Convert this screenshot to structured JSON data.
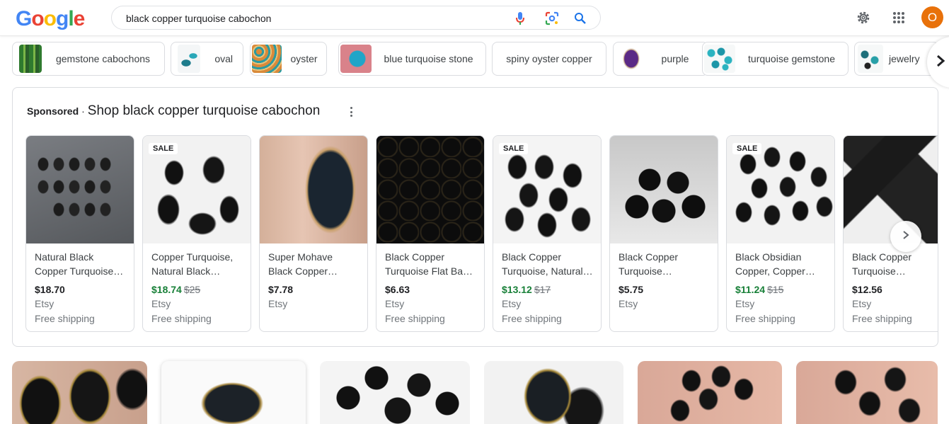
{
  "header": {
    "logo": "Google",
    "search_query": "black copper turquoise cabochon",
    "avatar_initial": "O",
    "icons": [
      "voice-search-icon",
      "lens-icon",
      "search-icon",
      "gear-icon",
      "apps-grid-icon"
    ]
  },
  "chips": [
    {
      "label": "gemstone cabochons"
    },
    {
      "label": "oval"
    },
    {
      "label": "oyster"
    },
    {
      "label": "blue turquoise stone"
    },
    {
      "label": "spiny oyster copper"
    },
    {
      "label": "purple"
    },
    {
      "label": "turquoise gemstone"
    },
    {
      "label": "jewelry"
    }
  ],
  "sponsored": {
    "label": "Sponsored",
    "separator": "·",
    "title": "Shop black copper turquoise cabochon",
    "products": [
      {
        "title1": "Natural Black",
        "title2": "Copper Turquoise…",
        "price": "$18.70",
        "orig": "",
        "store": "Etsy",
        "shipping": "Free shipping",
        "sale": ""
      },
      {
        "title1": "Copper Turquoise,",
        "title2": "Natural Black…",
        "price": "$18.74",
        "orig": "$25",
        "store": "Etsy",
        "shipping": "Free shipping",
        "sale": "SALE"
      },
      {
        "title1": "Super Mohave",
        "title2": "Black Copper…",
        "price": "$7.78",
        "orig": "",
        "store": "Etsy",
        "shipping": "",
        "sale": ""
      },
      {
        "title1": "Black Copper",
        "title2": "Turquoise Flat Ba…",
        "price": "$6.63",
        "orig": "",
        "store": "Etsy",
        "shipping": "Free shipping",
        "sale": ""
      },
      {
        "title1": "Black Copper",
        "title2": "Turquoise, Natural…",
        "price": "$13.12",
        "orig": "$17",
        "store": "Etsy",
        "shipping": "Free shipping",
        "sale": "SALE"
      },
      {
        "title1": "Black Copper",
        "title2": "Turquoise…",
        "price": "$5.75",
        "orig": "",
        "store": "Etsy",
        "shipping": "",
        "sale": ""
      },
      {
        "title1": "Black Obsidian",
        "title2": "Copper, Copper…",
        "price": "$11.24",
        "orig": "$15",
        "store": "Etsy",
        "shipping": "Free shipping",
        "sale": "SALE"
      },
      {
        "title1": "Black Copper",
        "title2": "Turquoise…",
        "price": "$12.56",
        "orig": "",
        "store": "Etsy",
        "shipping": "Free shipping",
        "sale": ""
      }
    ]
  },
  "colors": {
    "accent": "#1a73e8",
    "sale_price": "#188038",
    "avatar": "#e8710a"
  }
}
